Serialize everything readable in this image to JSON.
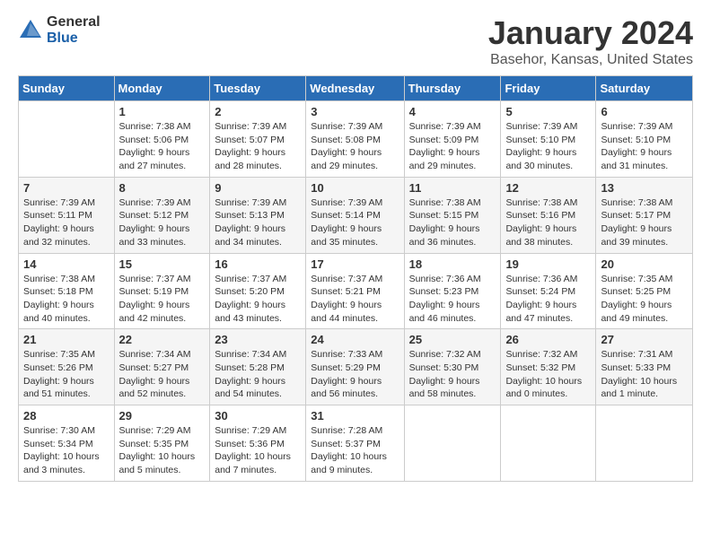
{
  "logo": {
    "general": "General",
    "blue": "Blue"
  },
  "header": {
    "month": "January 2024",
    "location": "Basehor, Kansas, United States"
  },
  "days_of_week": [
    "Sunday",
    "Monday",
    "Tuesday",
    "Wednesday",
    "Thursday",
    "Friday",
    "Saturday"
  ],
  "weeks": [
    [
      {
        "day": "",
        "info": ""
      },
      {
        "day": "1",
        "info": "Sunrise: 7:38 AM\nSunset: 5:06 PM\nDaylight: 9 hours\nand 27 minutes."
      },
      {
        "day": "2",
        "info": "Sunrise: 7:39 AM\nSunset: 5:07 PM\nDaylight: 9 hours\nand 28 minutes."
      },
      {
        "day": "3",
        "info": "Sunrise: 7:39 AM\nSunset: 5:08 PM\nDaylight: 9 hours\nand 29 minutes."
      },
      {
        "day": "4",
        "info": "Sunrise: 7:39 AM\nSunset: 5:09 PM\nDaylight: 9 hours\nand 29 minutes."
      },
      {
        "day": "5",
        "info": "Sunrise: 7:39 AM\nSunset: 5:10 PM\nDaylight: 9 hours\nand 30 minutes."
      },
      {
        "day": "6",
        "info": "Sunrise: 7:39 AM\nSunset: 5:10 PM\nDaylight: 9 hours\nand 31 minutes."
      }
    ],
    [
      {
        "day": "7",
        "info": "Sunrise: 7:39 AM\nSunset: 5:11 PM\nDaylight: 9 hours\nand 32 minutes."
      },
      {
        "day": "8",
        "info": "Sunrise: 7:39 AM\nSunset: 5:12 PM\nDaylight: 9 hours\nand 33 minutes."
      },
      {
        "day": "9",
        "info": "Sunrise: 7:39 AM\nSunset: 5:13 PM\nDaylight: 9 hours\nand 34 minutes."
      },
      {
        "day": "10",
        "info": "Sunrise: 7:39 AM\nSunset: 5:14 PM\nDaylight: 9 hours\nand 35 minutes."
      },
      {
        "day": "11",
        "info": "Sunrise: 7:38 AM\nSunset: 5:15 PM\nDaylight: 9 hours\nand 36 minutes."
      },
      {
        "day": "12",
        "info": "Sunrise: 7:38 AM\nSunset: 5:16 PM\nDaylight: 9 hours\nand 38 minutes."
      },
      {
        "day": "13",
        "info": "Sunrise: 7:38 AM\nSunset: 5:17 PM\nDaylight: 9 hours\nand 39 minutes."
      }
    ],
    [
      {
        "day": "14",
        "info": "Sunrise: 7:38 AM\nSunset: 5:18 PM\nDaylight: 9 hours\nand 40 minutes."
      },
      {
        "day": "15",
        "info": "Sunrise: 7:37 AM\nSunset: 5:19 PM\nDaylight: 9 hours\nand 42 minutes."
      },
      {
        "day": "16",
        "info": "Sunrise: 7:37 AM\nSunset: 5:20 PM\nDaylight: 9 hours\nand 43 minutes."
      },
      {
        "day": "17",
        "info": "Sunrise: 7:37 AM\nSunset: 5:21 PM\nDaylight: 9 hours\nand 44 minutes."
      },
      {
        "day": "18",
        "info": "Sunrise: 7:36 AM\nSunset: 5:23 PM\nDaylight: 9 hours\nand 46 minutes."
      },
      {
        "day": "19",
        "info": "Sunrise: 7:36 AM\nSunset: 5:24 PM\nDaylight: 9 hours\nand 47 minutes."
      },
      {
        "day": "20",
        "info": "Sunrise: 7:35 AM\nSunset: 5:25 PM\nDaylight: 9 hours\nand 49 minutes."
      }
    ],
    [
      {
        "day": "21",
        "info": "Sunrise: 7:35 AM\nSunset: 5:26 PM\nDaylight: 9 hours\nand 51 minutes."
      },
      {
        "day": "22",
        "info": "Sunrise: 7:34 AM\nSunset: 5:27 PM\nDaylight: 9 hours\nand 52 minutes."
      },
      {
        "day": "23",
        "info": "Sunrise: 7:34 AM\nSunset: 5:28 PM\nDaylight: 9 hours\nand 54 minutes."
      },
      {
        "day": "24",
        "info": "Sunrise: 7:33 AM\nSunset: 5:29 PM\nDaylight: 9 hours\nand 56 minutes."
      },
      {
        "day": "25",
        "info": "Sunrise: 7:32 AM\nSunset: 5:30 PM\nDaylight: 9 hours\nand 58 minutes."
      },
      {
        "day": "26",
        "info": "Sunrise: 7:32 AM\nSunset: 5:32 PM\nDaylight: 10 hours\nand 0 minutes."
      },
      {
        "day": "27",
        "info": "Sunrise: 7:31 AM\nSunset: 5:33 PM\nDaylight: 10 hours\nand 1 minute."
      }
    ],
    [
      {
        "day": "28",
        "info": "Sunrise: 7:30 AM\nSunset: 5:34 PM\nDaylight: 10 hours\nand 3 minutes."
      },
      {
        "day": "29",
        "info": "Sunrise: 7:29 AM\nSunset: 5:35 PM\nDaylight: 10 hours\nand 5 minutes."
      },
      {
        "day": "30",
        "info": "Sunrise: 7:29 AM\nSunset: 5:36 PM\nDaylight: 10 hours\nand 7 minutes."
      },
      {
        "day": "31",
        "info": "Sunrise: 7:28 AM\nSunset: 5:37 PM\nDaylight: 10 hours\nand 9 minutes."
      },
      {
        "day": "",
        "info": ""
      },
      {
        "day": "",
        "info": ""
      },
      {
        "day": "",
        "info": ""
      }
    ]
  ]
}
